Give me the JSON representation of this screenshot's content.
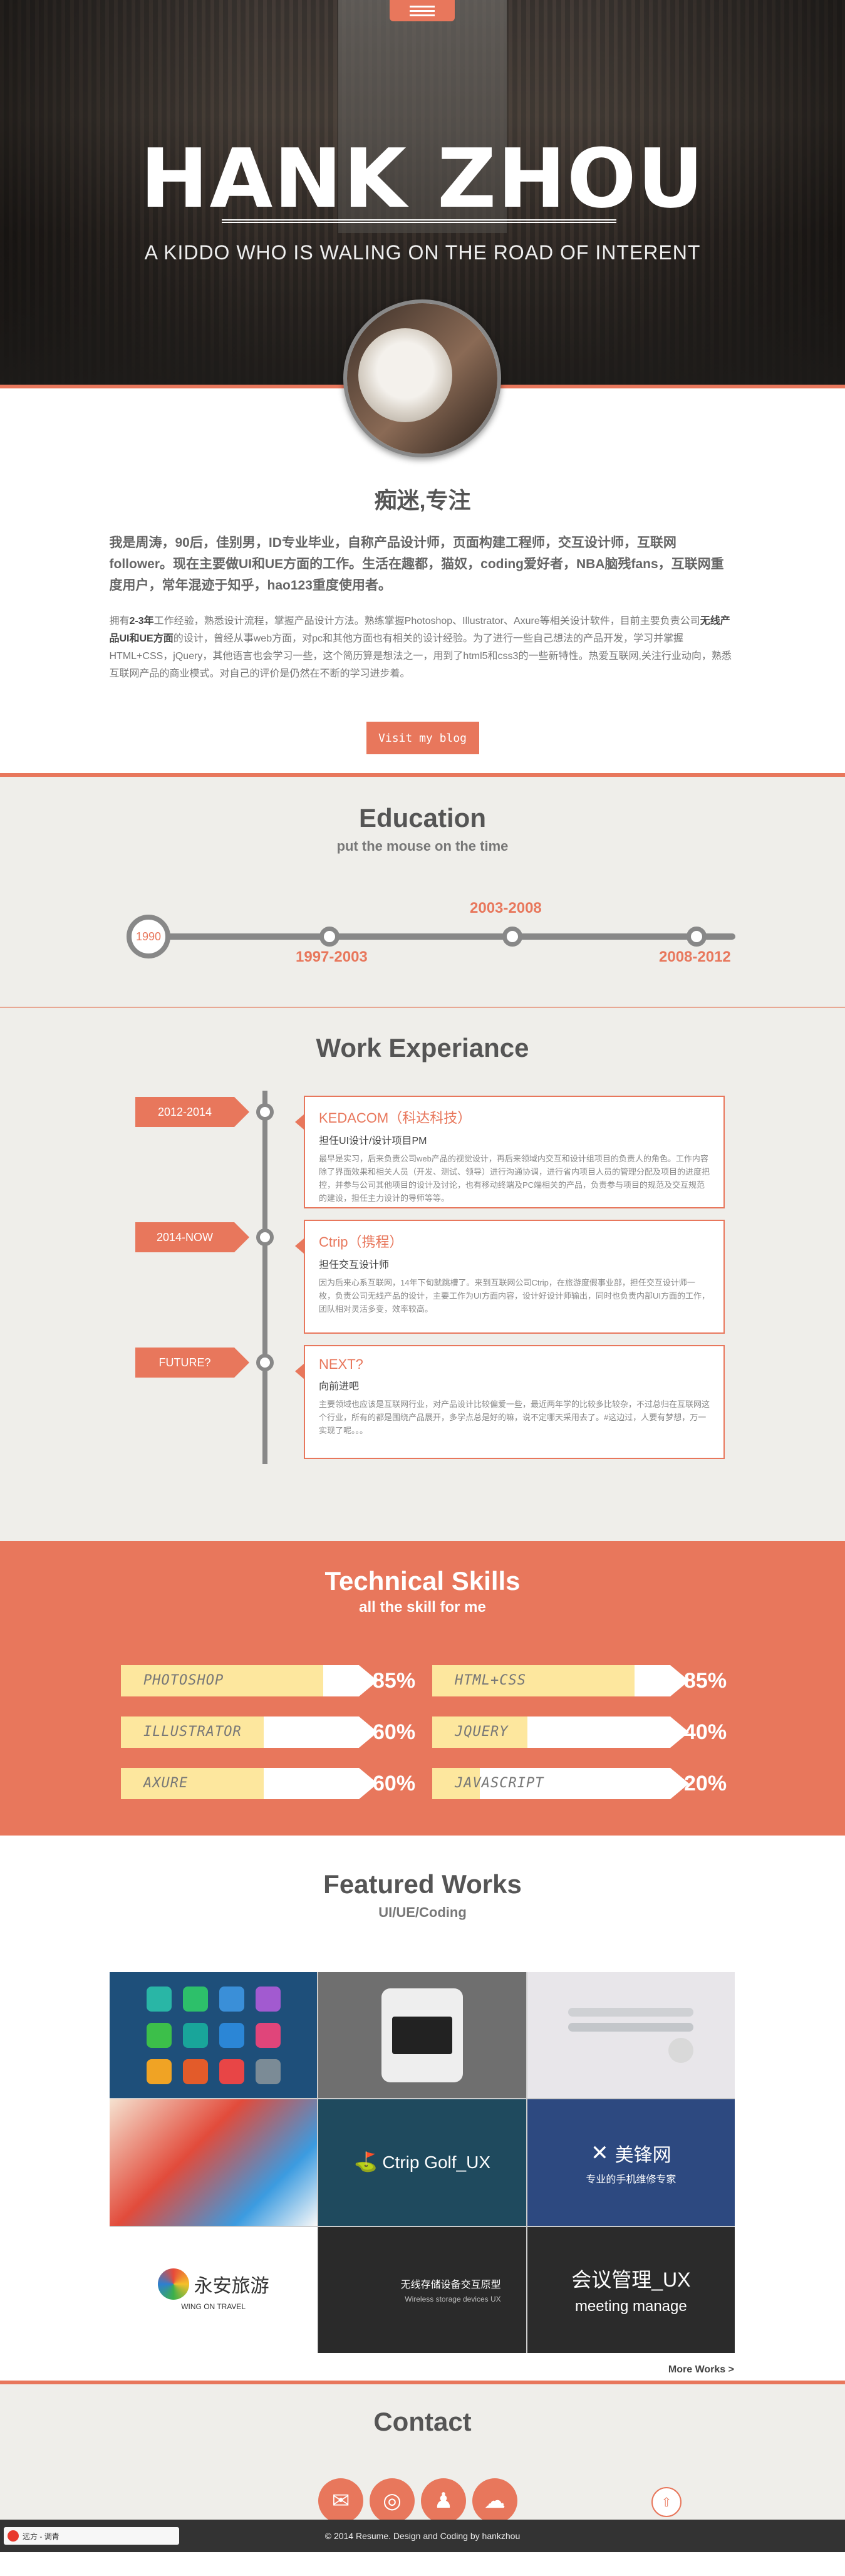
{
  "hero": {
    "title": "HANK ZHOU",
    "subtitle": "A KIDDO WHO IS WALING ON THE ROAD OF INTERENT",
    "menu_icon": "hamburger-icon"
  },
  "intro": {
    "title": "痴迷,专注",
    "lead": "我是周涛，90后，佳别男，ID专业毕业，自称产品设计师，页面构建工程师，交互设计师，互联网follower。现在主要做UI和UE方面的工作。生活在趣都，猫奴，coding爱好者，NBA脑残fans，互联网重度用户，常年混迹于知乎，hao123重度使用者。",
    "body_pre": "拥有",
    "body_years": "2-3年",
    "body_mid": "工作经验，熟悉设计流程，掌握产品设计方法。熟练掌握Photoshop、Illustrator、Axure等相关设计软件，目前主要负责公司",
    "body_bold": "无线产品UI和UE方面",
    "body_post": "的设计，曾经从事web方面，对pc和其他方面也有相关的设计经验。为了进行一些自己想法的产品开发，学习并掌握HTML+CSS，jQuery，其他语言也会学习一些，这个简历算是想法之一，用到了html5和css3的一些新特性。热爱互联网,关注行业动向，熟悉互联网产品的商业模式。对自己的评价是仍然在不断的学习进步着。",
    "blog_button": "Visit my blog"
  },
  "education": {
    "title": "Education",
    "subtitle": "put the mouse on the time",
    "nodes": [
      "1990",
      "1997-2003",
      "2003-2008",
      "2008-2012"
    ]
  },
  "work": {
    "title": "Work Experiance",
    "items": [
      {
        "period": "2012-2014",
        "company": "KEDACOM（科达科技）",
        "role": "担任UI设计/设计项目PM",
        "desc": "最早是实习，后来负责公司web产品的视觉设计，再后来领域内交互和设计组项目的负责人的角色。工作内容除了界面效果和相关人员（开发、测试、领导）进行沟通协调，进行省内项目人员的管理分配及项目的进度把控，并参与公司其他项目的设计及讨论，也有移动终端及PC端相关的产品，负责参与项目的规范及交互规范的建设，担任主力设计的导师等等。"
      },
      {
        "period": "2014-NOW",
        "company": "Ctrip（携程）",
        "role": "担任交互设计师",
        "desc": "因为后来心系互联网，14年下旬就跳槽了。来到互联网公司Ctrip，在旅游度假事业部，担任交互设计师一枚，负责公司无线产品的设计，主要工作为UI方面内容，设计好设计师输出，同时也负责内部UI方面的工作，团队相对灵活多变，效率较高。"
      },
      {
        "period": "FUTURE?",
        "company": "NEXT?",
        "role": "向前进吧",
        "desc": "主要领域也应该是互联网行业，对产品设计比较偏爱一些，最近两年学的比较多比较杂，不过总归在互联网这个行业，所有的都是围绕产品展开，多学点总是好的嘛，说不定哪天采用去了。#这边过，人要有梦想，万一实现了呢。。。"
      }
    ]
  },
  "skills": {
    "title": "Technical Skills",
    "subtitle": "all the skill for me",
    "items": [
      {
        "name": "PHOTOSHOP",
        "pct": "85%",
        "level": 0.85
      },
      {
        "name": "HTML+CSS",
        "pct": "85%",
        "level": 0.85
      },
      {
        "name": "ILLUSTRATOR",
        "pct": "60%",
        "level": 0.6
      },
      {
        "name": "JQUERY",
        "pct": "40%",
        "level": 0.4
      },
      {
        "name": "AXURE",
        "pct": "60%",
        "level": 0.6
      },
      {
        "name": "JAVASCRIPT",
        "pct": "20%",
        "level": 0.2
      }
    ]
  },
  "featured": {
    "title": "Featured Works",
    "subtitle": "UI/UE/Coding",
    "tiles": [
      {
        "label": ""
      },
      {
        "label": ""
      },
      {
        "label": ""
      },
      {
        "label": ""
      },
      {
        "label": "Ctrip Golf_UX"
      },
      {
        "label": "美锋网",
        "sub": "专业的手机维修专家"
      },
      {
        "label": "永安旅游",
        "sub": "WING ON TRAVEL"
      },
      {
        "label": "无线存储设备交互原型",
        "sub": "Wireless storage devices UX"
      },
      {
        "label": "会议管理_UX",
        "sub": "meeting manage"
      }
    ],
    "more": "More Works >"
  },
  "contact": {
    "title": "Contact",
    "icons": [
      "mail-icon",
      "weibo-icon",
      "qq-icon",
      "wechat-icon"
    ]
  },
  "footer": {
    "text": "© 2014 Resume. Design and Coding by hankzhou",
    "music": "远方 - 调青"
  },
  "colors": {
    "accent": "#e8775c",
    "gray": "#888888",
    "bg": "#efeeea"
  }
}
